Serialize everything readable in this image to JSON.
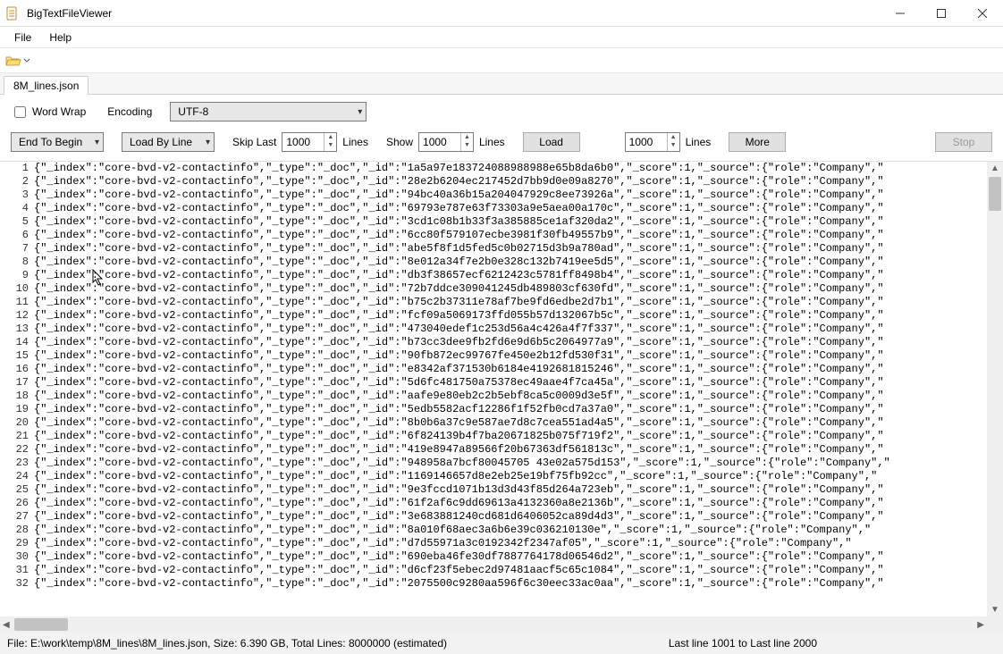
{
  "window": {
    "title": "BigTextFileViewer"
  },
  "menu": {
    "file": "File",
    "help": "Help"
  },
  "tab": {
    "name": "8M_lines.json"
  },
  "options": {
    "wordwrap_label": "Word Wrap",
    "encoding_label": "Encoding",
    "encoding_value": "UTF-8",
    "direction_value": "End To Begin",
    "loadmode_value": "Load By Line",
    "skip_last_label": "Skip Last",
    "skip_last_value": "1000",
    "lines_label": "Lines",
    "show_label": "Show",
    "show_value": "1000",
    "load_label": "Load",
    "more_value": "1000",
    "more_label": "More",
    "stop_label": "Stop"
  },
  "status": {
    "left": "File: E:\\work\\temp\\8M_lines\\8M_lines.json, Size:    6.390 GB, Total Lines: 8000000 (estimated)",
    "right": "Last line 1001 to Last line 2000"
  },
  "content_template": {
    "prefix": "{\"_index\":\"core-bvd-v2-contactinfo\",\"_type\":\"_doc\",\"_id\":\"",
    "suffix": "\",\"_score\":1,\"_source\":{\"role\":\"Company\",\""
  },
  "lines": [
    {
      "n": 1,
      "id": "1a5a97e183724088988988e65b8da6b0"
    },
    {
      "n": 2,
      "id": "28e2b6204ec217452d7bb9d0e09a8270"
    },
    {
      "n": 3,
      "id": "94bc40a36b15a204047929c8ee73926a"
    },
    {
      "n": 4,
      "id": "69793e787e63f73303a9e5aea00a170c"
    },
    {
      "n": 5,
      "id": "3cd1c08b1b33f3a385885ce1af320da2"
    },
    {
      "n": 6,
      "id": "6cc80f579107ecbe3981f30fb49557b9"
    },
    {
      "n": 7,
      "id": "abe5f8f1d5fed5c0b02715d3b9a780ad"
    },
    {
      "n": 8,
      "id": "8e012a34f7e2b0e328c132b7419ee5d5"
    },
    {
      "n": 9,
      "id": "db3f38657ecf6212423c5781ff8498b4"
    },
    {
      "n": 10,
      "id": "72b7ddce309041245db489803cf630fd"
    },
    {
      "n": 11,
      "id": "b75c2b37311e78af7be9fd6edbe2d7b1"
    },
    {
      "n": 12,
      "id": "fcf09a5069173ffd055b57d132067b5c"
    },
    {
      "n": 13,
      "id": "473040edef1c253d56a4c426a4f7f337"
    },
    {
      "n": 14,
      "id": "b73cc3dee9fb2fd6e9d6b5c2064977a9"
    },
    {
      "n": 15,
      "id": "90fb872ec99767fe450e2b12fd530f31"
    },
    {
      "n": 16,
      "id": "e8342af371530b6184e4192681815246"
    },
    {
      "n": 17,
      "id": "5d6fc481750a75378ec49aae4f7ca45a"
    },
    {
      "n": 18,
      "id": "aafe9e80eb2c2b5ebf8ca5c0009d3e5f"
    },
    {
      "n": 19,
      "id": "5edb5582acf12286f1f52fb0cd7a37a0"
    },
    {
      "n": 20,
      "id": "8b0b6a37c9e587ae7d8c7cea551ad4a5"
    },
    {
      "n": 21,
      "id": "6f824139b4f7ba20671825b075f719f2"
    },
    {
      "n": 22,
      "id": "419e8947a89566f20b67363df561813c"
    },
    {
      "n": 23,
      "id": "948958a7bcf80045705 43e02a575d153"
    },
    {
      "n": 24,
      "id": "1169146657d8e2eb25e19bf75fb92cc"
    },
    {
      "n": 25,
      "id": "9e3fccd1071b13d3d43f85d264a723eb"
    },
    {
      "n": 26,
      "id": "61f2af6c9dd69613a4132360a8e2136b"
    },
    {
      "n": 27,
      "id": "3e683881240cd681d6406052ca89d4d3"
    },
    {
      "n": 28,
      "id": "8a010f68aec3a6b6e39c036210130e"
    },
    {
      "n": 29,
      "id": "d7d55971a3c0192342f2347af05"
    },
    {
      "n": 30,
      "id": "690eba46fe30df7887764178d06546d2"
    },
    {
      "n": 31,
      "id": "d6cf23f5ebec2d97481aacf5c65c1084"
    },
    {
      "n": 32,
      "id": "2075500c9280aa596f6c30eec33ac0aa"
    }
  ]
}
